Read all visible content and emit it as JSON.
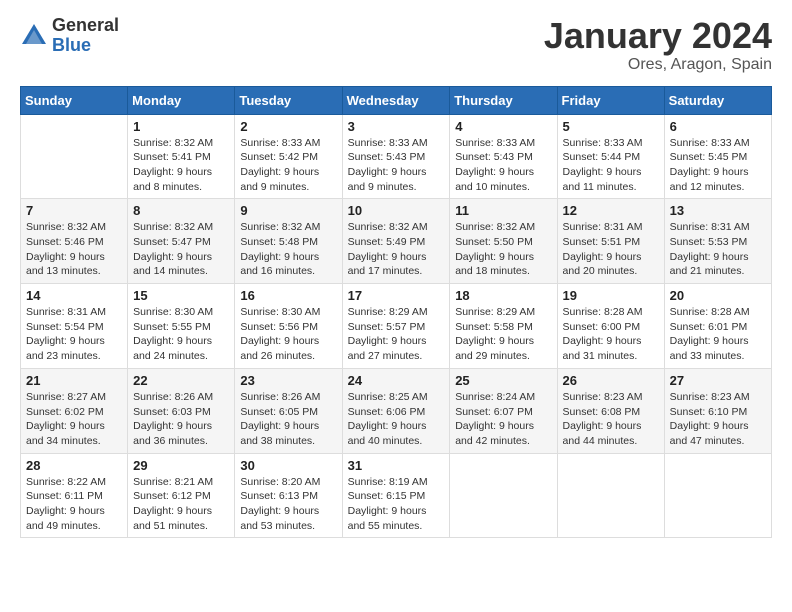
{
  "logo": {
    "general": "General",
    "blue": "Blue"
  },
  "title": "January 2024",
  "location": "Ores, Aragon, Spain",
  "days_header": [
    "Sunday",
    "Monday",
    "Tuesday",
    "Wednesday",
    "Thursday",
    "Friday",
    "Saturday"
  ],
  "weeks": [
    [
      {
        "day": "",
        "sunrise": "",
        "sunset": "",
        "daylight": ""
      },
      {
        "day": "1",
        "sunrise": "Sunrise: 8:32 AM",
        "sunset": "Sunset: 5:41 PM",
        "daylight": "Daylight: 9 hours and 8 minutes."
      },
      {
        "day": "2",
        "sunrise": "Sunrise: 8:33 AM",
        "sunset": "Sunset: 5:42 PM",
        "daylight": "Daylight: 9 hours and 9 minutes."
      },
      {
        "day": "3",
        "sunrise": "Sunrise: 8:33 AM",
        "sunset": "Sunset: 5:43 PM",
        "daylight": "Daylight: 9 hours and 9 minutes."
      },
      {
        "day": "4",
        "sunrise": "Sunrise: 8:33 AM",
        "sunset": "Sunset: 5:43 PM",
        "daylight": "Daylight: 9 hours and 10 minutes."
      },
      {
        "day": "5",
        "sunrise": "Sunrise: 8:33 AM",
        "sunset": "Sunset: 5:44 PM",
        "daylight": "Daylight: 9 hours and 11 minutes."
      },
      {
        "day": "6",
        "sunrise": "Sunrise: 8:33 AM",
        "sunset": "Sunset: 5:45 PM",
        "daylight": "Daylight: 9 hours and 12 minutes."
      }
    ],
    [
      {
        "day": "7",
        "sunrise": "Sunrise: 8:32 AM",
        "sunset": "Sunset: 5:46 PM",
        "daylight": "Daylight: 9 hours and 13 minutes."
      },
      {
        "day": "8",
        "sunrise": "Sunrise: 8:32 AM",
        "sunset": "Sunset: 5:47 PM",
        "daylight": "Daylight: 9 hours and 14 minutes."
      },
      {
        "day": "9",
        "sunrise": "Sunrise: 8:32 AM",
        "sunset": "Sunset: 5:48 PM",
        "daylight": "Daylight: 9 hours and 16 minutes."
      },
      {
        "day": "10",
        "sunrise": "Sunrise: 8:32 AM",
        "sunset": "Sunset: 5:49 PM",
        "daylight": "Daylight: 9 hours and 17 minutes."
      },
      {
        "day": "11",
        "sunrise": "Sunrise: 8:32 AM",
        "sunset": "Sunset: 5:50 PM",
        "daylight": "Daylight: 9 hours and 18 minutes."
      },
      {
        "day": "12",
        "sunrise": "Sunrise: 8:31 AM",
        "sunset": "Sunset: 5:51 PM",
        "daylight": "Daylight: 9 hours and 20 minutes."
      },
      {
        "day": "13",
        "sunrise": "Sunrise: 8:31 AM",
        "sunset": "Sunset: 5:53 PM",
        "daylight": "Daylight: 9 hours and 21 minutes."
      }
    ],
    [
      {
        "day": "14",
        "sunrise": "Sunrise: 8:31 AM",
        "sunset": "Sunset: 5:54 PM",
        "daylight": "Daylight: 9 hours and 23 minutes."
      },
      {
        "day": "15",
        "sunrise": "Sunrise: 8:30 AM",
        "sunset": "Sunset: 5:55 PM",
        "daylight": "Daylight: 9 hours and 24 minutes."
      },
      {
        "day": "16",
        "sunrise": "Sunrise: 8:30 AM",
        "sunset": "Sunset: 5:56 PM",
        "daylight": "Daylight: 9 hours and 26 minutes."
      },
      {
        "day": "17",
        "sunrise": "Sunrise: 8:29 AM",
        "sunset": "Sunset: 5:57 PM",
        "daylight": "Daylight: 9 hours and 27 minutes."
      },
      {
        "day": "18",
        "sunrise": "Sunrise: 8:29 AM",
        "sunset": "Sunset: 5:58 PM",
        "daylight": "Daylight: 9 hours and 29 minutes."
      },
      {
        "day": "19",
        "sunrise": "Sunrise: 8:28 AM",
        "sunset": "Sunset: 6:00 PM",
        "daylight": "Daylight: 9 hours and 31 minutes."
      },
      {
        "day": "20",
        "sunrise": "Sunrise: 8:28 AM",
        "sunset": "Sunset: 6:01 PM",
        "daylight": "Daylight: 9 hours and 33 minutes."
      }
    ],
    [
      {
        "day": "21",
        "sunrise": "Sunrise: 8:27 AM",
        "sunset": "Sunset: 6:02 PM",
        "daylight": "Daylight: 9 hours and 34 minutes."
      },
      {
        "day": "22",
        "sunrise": "Sunrise: 8:26 AM",
        "sunset": "Sunset: 6:03 PM",
        "daylight": "Daylight: 9 hours and 36 minutes."
      },
      {
        "day": "23",
        "sunrise": "Sunrise: 8:26 AM",
        "sunset": "Sunset: 6:05 PM",
        "daylight": "Daylight: 9 hours and 38 minutes."
      },
      {
        "day": "24",
        "sunrise": "Sunrise: 8:25 AM",
        "sunset": "Sunset: 6:06 PM",
        "daylight": "Daylight: 9 hours and 40 minutes."
      },
      {
        "day": "25",
        "sunrise": "Sunrise: 8:24 AM",
        "sunset": "Sunset: 6:07 PM",
        "daylight": "Daylight: 9 hours and 42 minutes."
      },
      {
        "day": "26",
        "sunrise": "Sunrise: 8:23 AM",
        "sunset": "Sunset: 6:08 PM",
        "daylight": "Daylight: 9 hours and 44 minutes."
      },
      {
        "day": "27",
        "sunrise": "Sunrise: 8:23 AM",
        "sunset": "Sunset: 6:10 PM",
        "daylight": "Daylight: 9 hours and 47 minutes."
      }
    ],
    [
      {
        "day": "28",
        "sunrise": "Sunrise: 8:22 AM",
        "sunset": "Sunset: 6:11 PM",
        "daylight": "Daylight: 9 hours and 49 minutes."
      },
      {
        "day": "29",
        "sunrise": "Sunrise: 8:21 AM",
        "sunset": "Sunset: 6:12 PM",
        "daylight": "Daylight: 9 hours and 51 minutes."
      },
      {
        "day": "30",
        "sunrise": "Sunrise: 8:20 AM",
        "sunset": "Sunset: 6:13 PM",
        "daylight": "Daylight: 9 hours and 53 minutes."
      },
      {
        "day": "31",
        "sunrise": "Sunrise: 8:19 AM",
        "sunset": "Sunset: 6:15 PM",
        "daylight": "Daylight: 9 hours and 55 minutes."
      },
      {
        "day": "",
        "sunrise": "",
        "sunset": "",
        "daylight": ""
      },
      {
        "day": "",
        "sunrise": "",
        "sunset": "",
        "daylight": ""
      },
      {
        "day": "",
        "sunrise": "",
        "sunset": "",
        "daylight": ""
      }
    ]
  ]
}
